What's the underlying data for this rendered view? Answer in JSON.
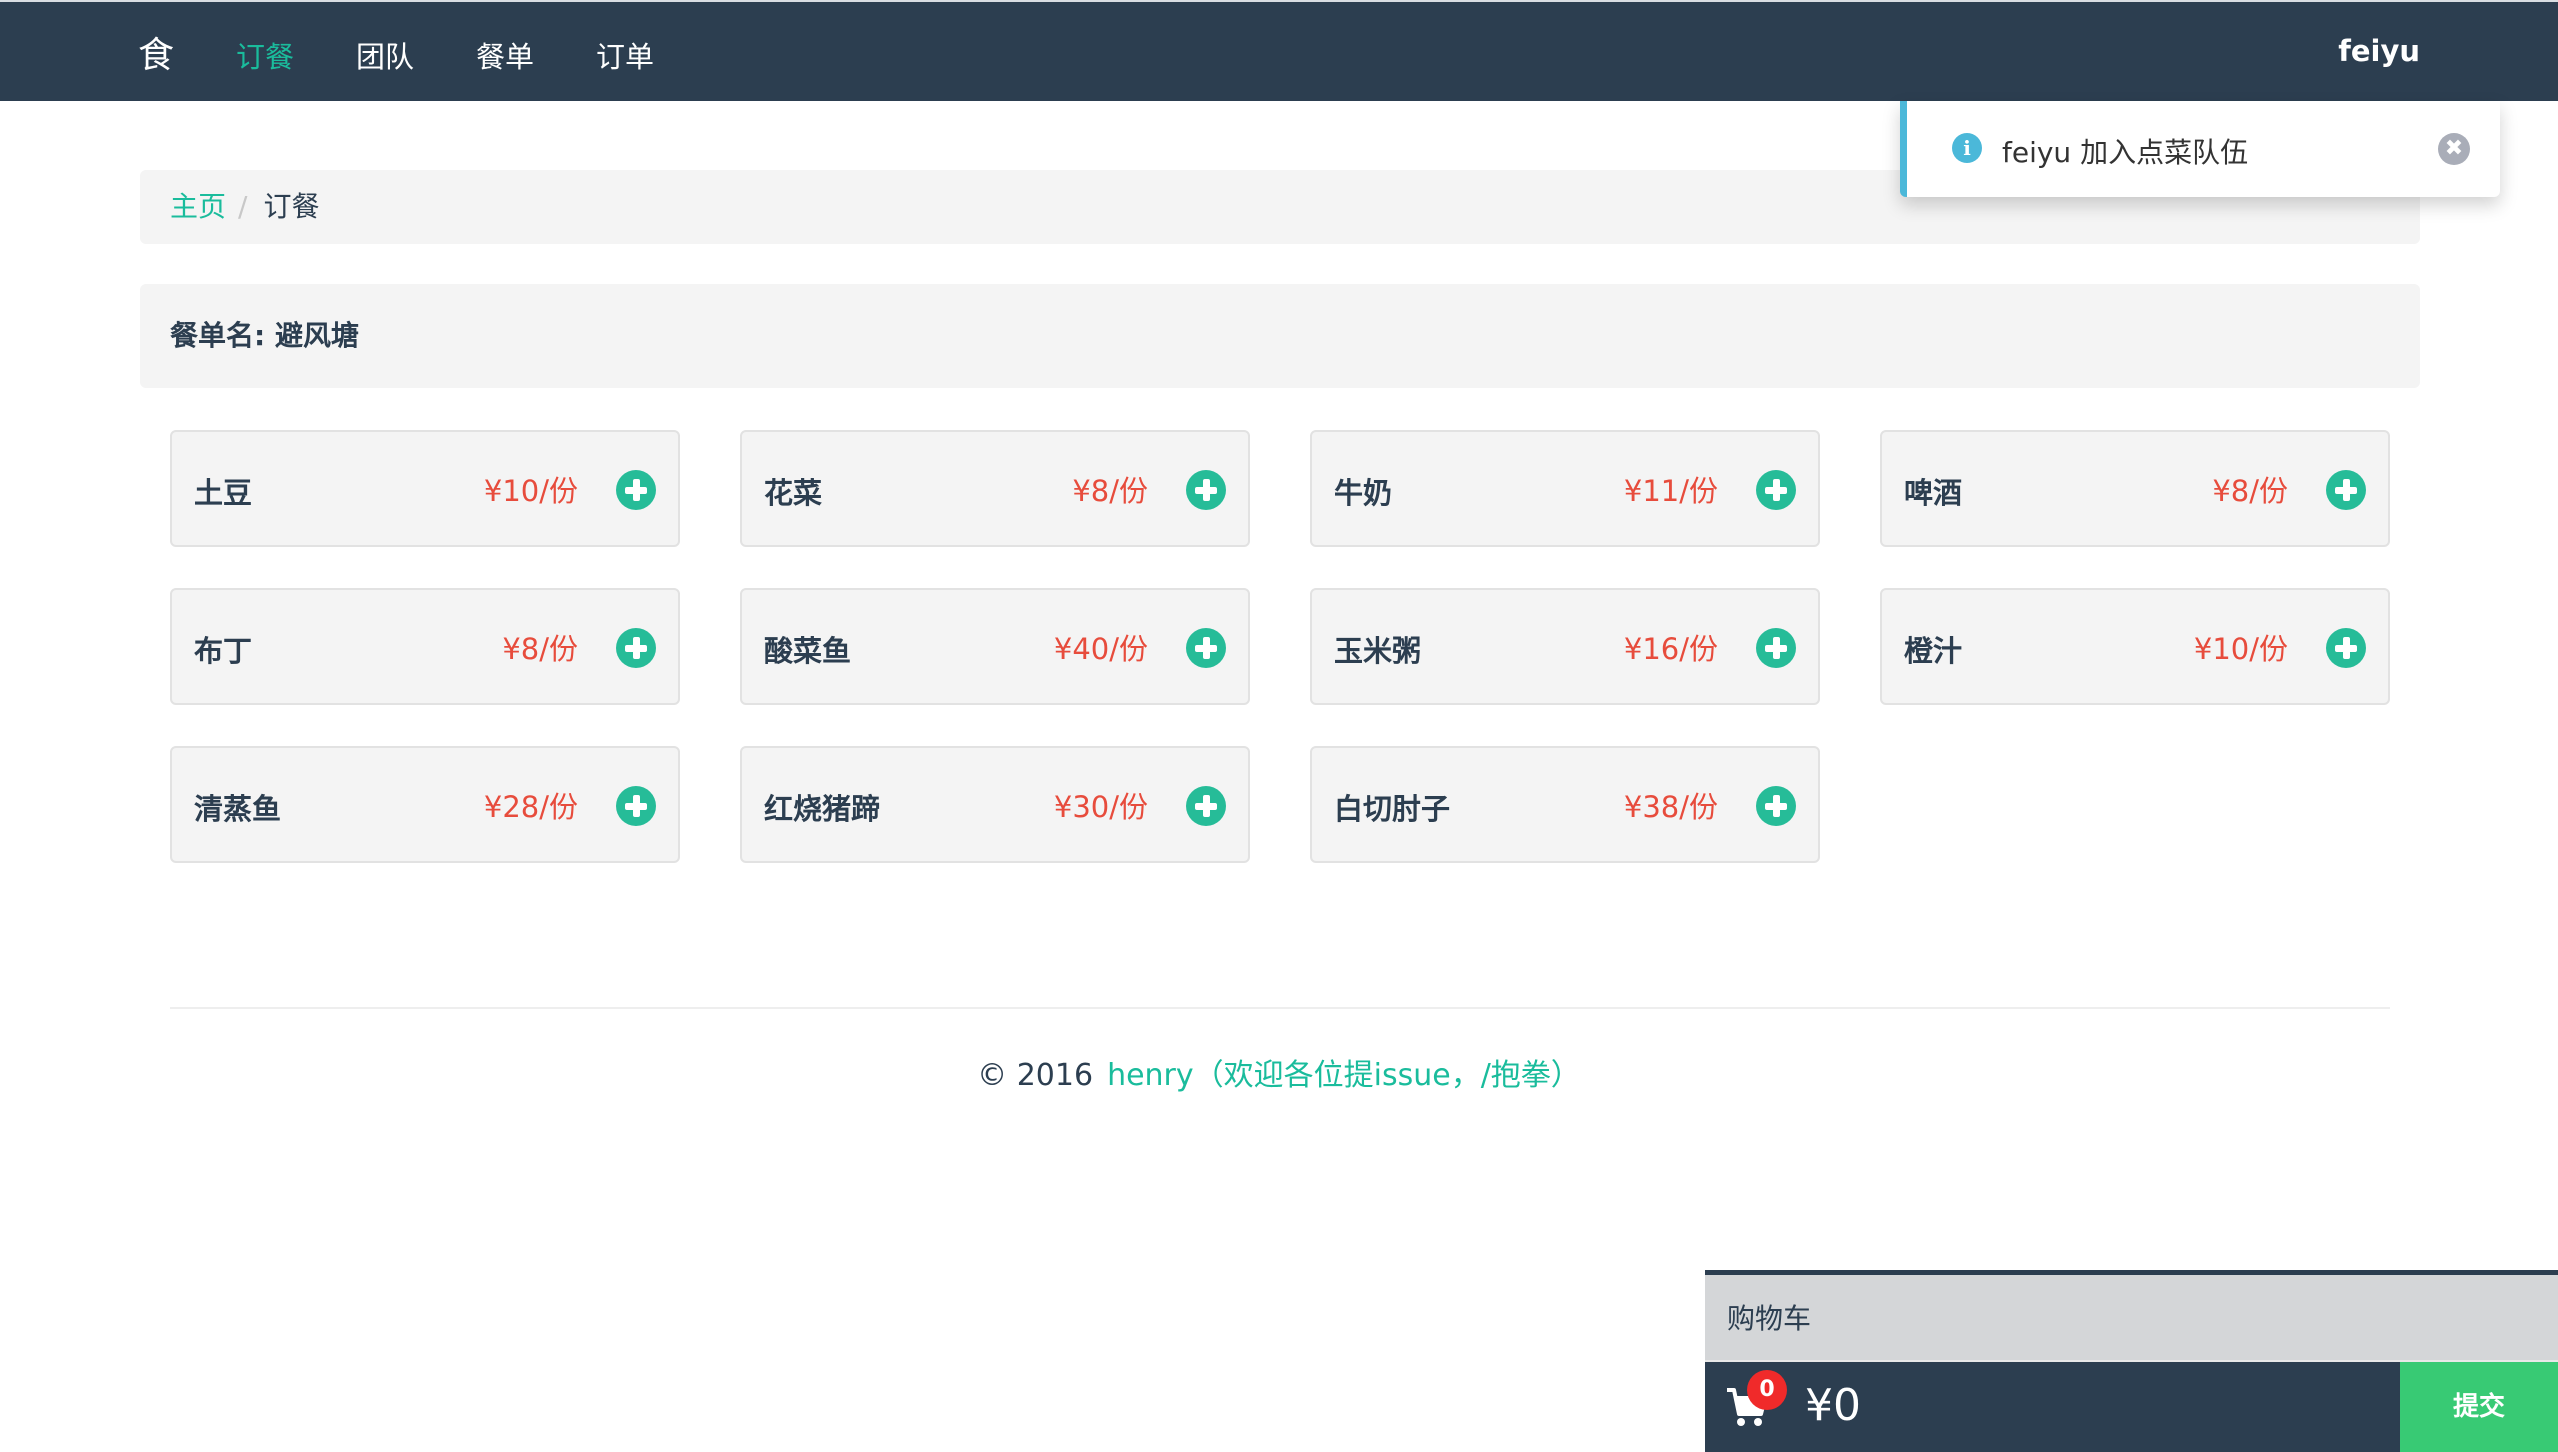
{
  "navbar": {
    "brand": "食",
    "items": [
      {
        "label": "订餐",
        "active": true
      },
      {
        "label": "团队",
        "active": false
      },
      {
        "label": "餐单",
        "active": false
      },
      {
        "label": "订单",
        "active": false
      }
    ],
    "user": "feiyu"
  },
  "breadcrumb": {
    "home": "主页",
    "separator": "/",
    "current": "订餐"
  },
  "menu": {
    "name_label": "餐单名: 避风塘"
  },
  "dishes": [
    {
      "name": "土豆",
      "price": "¥10/份"
    },
    {
      "name": "花菜",
      "price": "¥8/份"
    },
    {
      "name": "牛奶",
      "price": "¥11/份"
    },
    {
      "name": "啤酒",
      "price": "¥8/份"
    },
    {
      "name": "布丁",
      "price": "¥8/份"
    },
    {
      "name": "酸菜鱼",
      "price": "¥40/份"
    },
    {
      "name": "玉米粥",
      "price": "¥16/份"
    },
    {
      "name": "橙汁",
      "price": "¥10/份"
    },
    {
      "name": "清蒸鱼",
      "price": "¥28/份"
    },
    {
      "name": "红烧猪蹄",
      "price": "¥30/份"
    },
    {
      "name": "白切肘子",
      "price": "¥38/份"
    }
  ],
  "footer": {
    "copyright": "© 2016",
    "link": "henry（欢迎各位提issue，/抱拳）"
  },
  "notification": {
    "icon": "info-icon",
    "text": "feiyu 加入点菜队伍",
    "close_icon": "close-icon"
  },
  "cart": {
    "title": "购物车",
    "count": "0",
    "total": "¥0",
    "submit_label": "提交"
  },
  "colors": {
    "navbar": "#2c3e50",
    "accent": "#1abc9c",
    "price": "#e74c3c",
    "submit": "#38ca74",
    "badge": "#f02a2a",
    "info": "#4bb8d9"
  }
}
